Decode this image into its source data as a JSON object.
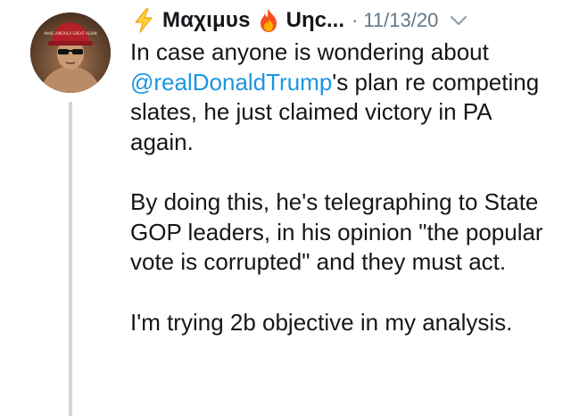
{
  "tweet": {
    "display_name": "Μαχιμυs",
    "display_name_2": "Uηc...",
    "separator": "·",
    "timestamp": "11/13/20",
    "avatar_hat_text": "MAKE AMERICA GREAT AGAIN",
    "icons": {
      "name_emoji_1": "lightning-bolt-icon",
      "name_emoji_2": "fire-icon",
      "menu": "chevron-down-icon"
    },
    "colors": {
      "text": "#14171a",
      "secondary": "#657786",
      "mention": "#1b95e0",
      "thread_line": "#ccd6dd"
    },
    "body": {
      "p1_pre": "In case anyone is wondering about ",
      "p1_mention": "@realDonaldTrump",
      "p1_post": "'s plan re competing slates, he just claimed victory in PA again.",
      "p2": "By doing this, he's telegraphing to State GOP leaders, in his opinion \"the popular vote is corrupted\" and they must act.",
      "p3": "I'm trying 2b objective in my analysis."
    }
  }
}
